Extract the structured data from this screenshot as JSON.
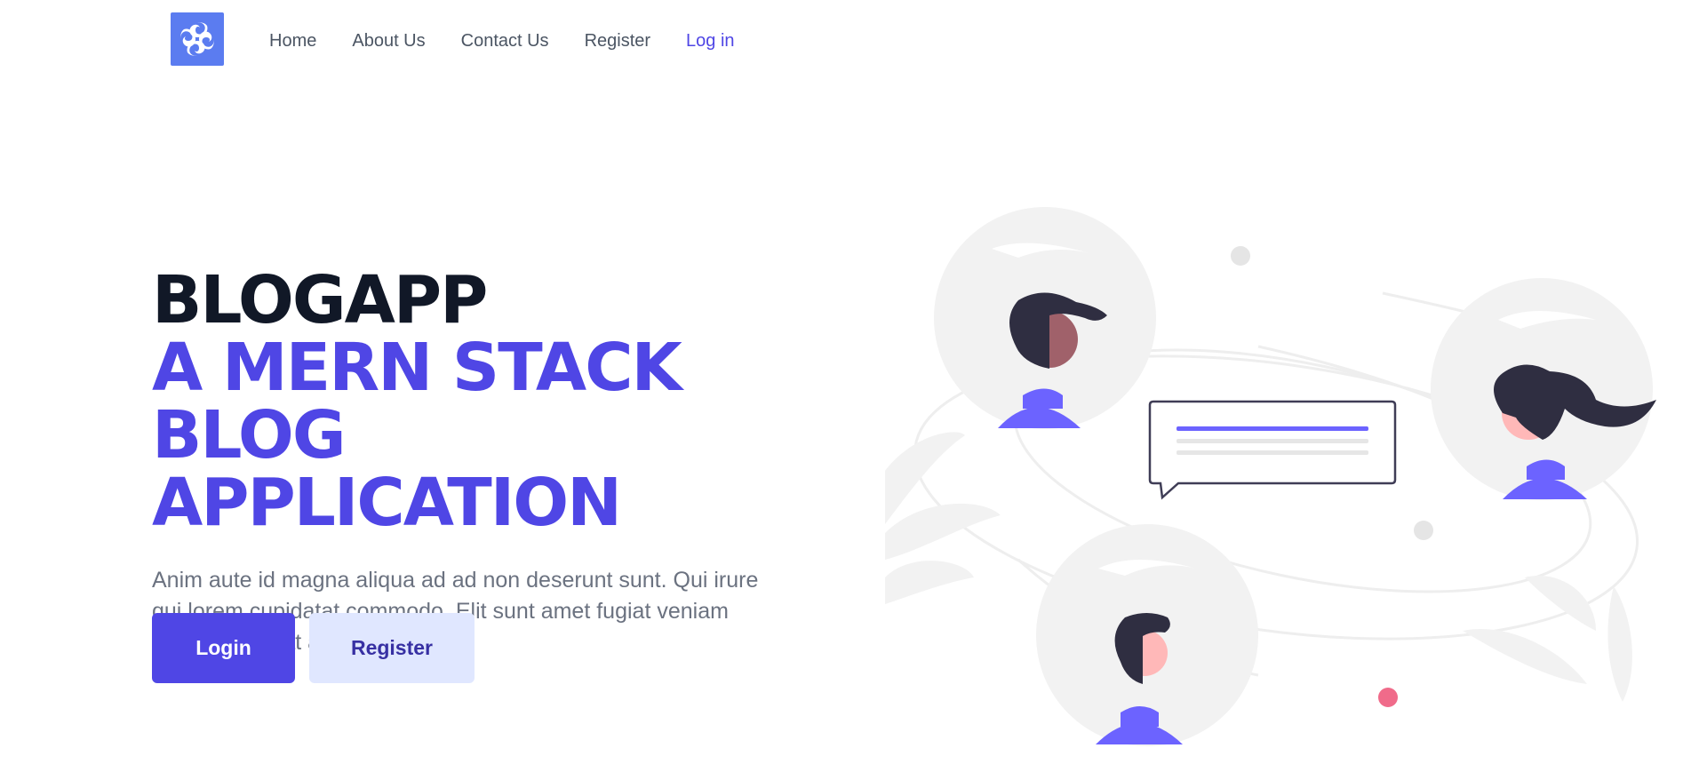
{
  "nav": {
    "logo_icon": "swirl-logo-icon",
    "links": [
      "Home",
      "About Us",
      "Contact Us",
      "Register",
      "Log in"
    ]
  },
  "hero": {
    "title_line1": "BLOGAPP",
    "title_line2": "A MERN STACK BLOG",
    "title_line3": "APPLICATION",
    "description": "Anim aute id magna aliqua ad ad non deserunt sunt. Qui irure qui lorem cupidatat commodo. Elit sunt amet fugiat veniam occaecat fugiat aliqua.",
    "primary_button": "Login",
    "secondary_button": "Register"
  },
  "colors": {
    "accent": "#4f46e5",
    "logo_bg": "#5b7cf0",
    "secondary_btn_bg": "#e0e7ff",
    "illustration_purple": "#6c63ff"
  }
}
